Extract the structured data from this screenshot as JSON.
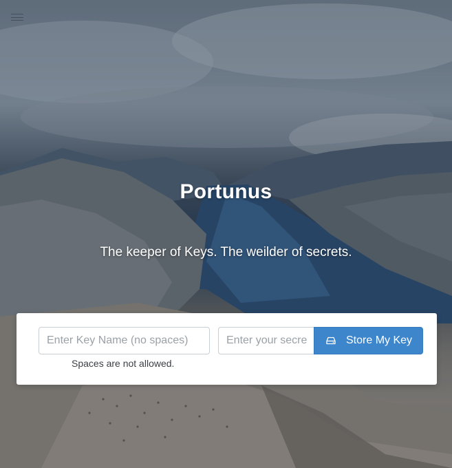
{
  "header": {
    "menu_icon": "hamburger-menu-icon"
  },
  "hero": {
    "title": "Portunus",
    "subtitle": "The keeper of Keys. The weilder of secrets."
  },
  "form": {
    "key_name": {
      "value": "",
      "placeholder": "Enter Key Name (no spaces)"
    },
    "secret": {
      "value": "",
      "placeholder": "Enter your secret"
    },
    "submit_label": "Store My Key",
    "submit_icon": "hard-drive-icon",
    "help_text": "Spaces are not allowed."
  },
  "colors": {
    "primary_button": "#3d86cc",
    "card_background": "#ffffff",
    "title_text": "#ffffff"
  }
}
